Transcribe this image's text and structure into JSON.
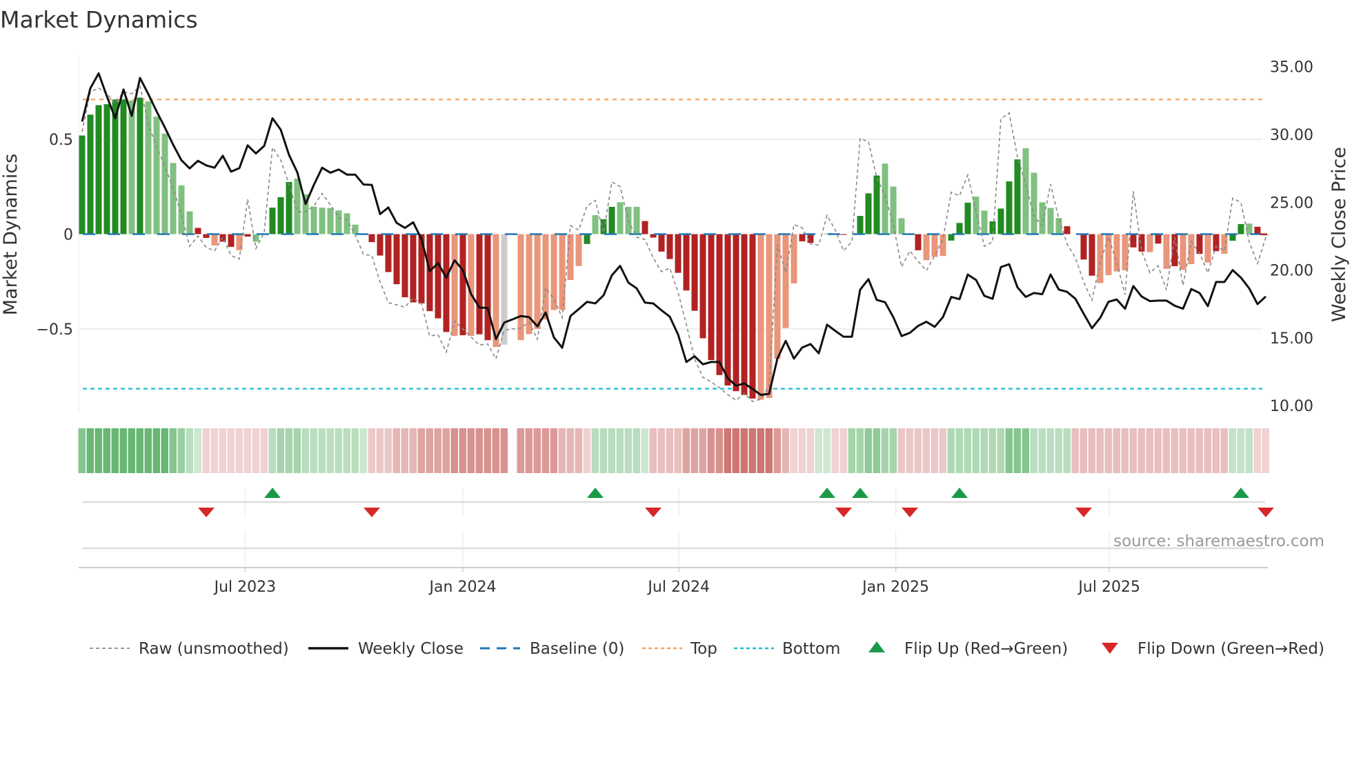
{
  "chart_data": {
    "type": "bar",
    "title": "Market Dynamics",
    "ylabel_left": "Market Dynamics",
    "ylabel_right": "Weekly Close Price",
    "source": "source: sharemaestro.com",
    "x_unit": "weeks since first bar",
    "ylim_left": [
      -0.94,
      0.94
    ],
    "ylim_right": [
      9.5,
      35.8
    ],
    "left_ticks": [
      {
        "value": 0.5,
        "label": "0.5"
      },
      {
        "value": 0,
        "label": "0"
      },
      {
        "value": -0.5,
        "label": "−0.5"
      }
    ],
    "right_ticks": [
      {
        "value": 35,
        "label": "35.00"
      },
      {
        "value": 30,
        "label": "30.00"
      },
      {
        "value": 25,
        "label": "25.00"
      },
      {
        "value": 20,
        "label": "20.00"
      },
      {
        "value": 15,
        "label": "15.00"
      },
      {
        "value": 10,
        "label": "10.00"
      }
    ],
    "x_ticks": [
      {
        "label": "Jul 2023",
        "week": 19.7
      },
      {
        "label": "Jan 2024",
        "week": 46.0
      },
      {
        "label": "Jul 2024",
        "week": 72.1
      },
      {
        "label": "Jan 2025",
        "week": 98.3
      },
      {
        "label": "Jul 2025",
        "week": 124.1
      }
    ],
    "top_level": 0.71,
    "bottom_level": -0.815,
    "baseline": 0,
    "colors": {
      "G": "#228b22",
      "g": "#80c080",
      "R": "#b22222",
      "r": "#e9967a",
      "raw": "#888888",
      "close": "#111111",
      "baseline": "#1f77b4",
      "top": "#f4a460",
      "bottom": "#17becf",
      "flip_up": "#1a9a48",
      "flip_down": "#d62728",
      "strip_pos": "#3fa34d",
      "strip_neg": "#c0504d"
    },
    "dynamics": [
      0.52,
      0.63,
      0.68,
      0.685,
      0.71,
      0.71,
      0.705,
      0.72,
      0.7,
      0.62,
      0.53,
      0.375,
      0.257,
      0.12,
      0.033,
      -0.02,
      -0.06,
      -0.04,
      -0.067,
      -0.085,
      -0.013,
      -0.04,
      0,
      0.14,
      0.195,
      0.275,
      0.293,
      0.21,
      0.145,
      0.14,
      0.138,
      0.125,
      0.11,
      0.05,
      0,
      -0.042,
      -0.113,
      -0.2,
      -0.264,
      -0.333,
      -0.36,
      -0.365,
      -0.406,
      -0.444,
      -0.516,
      -0.537,
      -0.533,
      -0.537,
      -0.528,
      -0.559,
      -0.595,
      -0.583,
      null,
      -0.559,
      -0.527,
      -0.5,
      -0.45,
      -0.4,
      -0.4,
      -0.242,
      -0.168,
      -0.052,
      0.1,
      0.079,
      0.144,
      0.168,
      0.144,
      0.144,
      0.069,
      -0.018,
      -0.092,
      -0.131,
      -0.204,
      -0.297,
      -0.404,
      -0.549,
      -0.664,
      -0.743,
      -0.798,
      -0.828,
      -0.848,
      -0.867,
      -0.873,
      -0.864,
      -0.658,
      -0.495,
      -0.26,
      -0.038,
      -0.046,
      0,
      0.004,
      0,
      -0.004,
      0,
      0.096,
      0.215,
      0.309,
      0.372,
      0.251,
      0.084,
      0,
      -0.085,
      -0.137,
      -0.12,
      -0.115,
      -0.034,
      0.059,
      0.166,
      0.198,
      0.124,
      0.067,
      0.135,
      0.278,
      0.394,
      0.453,
      0.324,
      0.168,
      0.138,
      0.085,
      0.042,
      0,
      -0.134,
      -0.219,
      -0.258,
      -0.216,
      -0.197,
      -0.191,
      -0.07,
      -0.092,
      -0.095,
      -0.05,
      -0.183,
      -0.169,
      -0.188,
      -0.158,
      -0.104,
      -0.15,
      -0.09,
      -0.104,
      -0.035,
      0.053,
      0.056,
      0.039,
      -0.008
    ],
    "shades": "GGGGGGgGggggggRRrRRrRgGGGGggggggggRRRRRRRRRRRrRrRRr-rrrrrrrrrGgGGgggRRRRRRRRRRRRRRrrrrrRRggRRGGGGgggRRrrrGGGggGGGGgggggRRRRrrrrRRrRrRrrRrRrGGgR",
    "raw": [
      0.54,
      0.75,
      0.77,
      0.74,
      0.69,
      0.75,
      0.74,
      0.78,
      0.58,
      0.46,
      0.36,
      0.24,
      0.105,
      -0.064,
      -0.01,
      -0.07,
      -0.088,
      -0.016,
      -0.113,
      -0.131,
      0.184,
      -0.076,
      0.008,
      0.457,
      0.39,
      0.263,
      0.118,
      0.118,
      0.148,
      0.215,
      0.154,
      0.087,
      0.075,
      -0.004,
      -0.107,
      -0.113,
      -0.252,
      -0.361,
      -0.373,
      -0.385,
      -0.337,
      -0.367,
      -0.537,
      -0.531,
      -0.622,
      -0.458,
      -0.5,
      -0.543,
      -0.585,
      -0.579,
      -0.658,
      -0.507,
      -0.5,
      -0.495,
      -0.464,
      -0.555,
      -0.282,
      -0.343,
      -0.44,
      0.045,
      0.021,
      0.148,
      0.178,
      0.008,
      0.275,
      0.251,
      0.069,
      -0.016,
      -0.028,
      -0.125,
      -0.198,
      -0.179,
      -0.307,
      -0.476,
      -0.658,
      -0.755,
      -0.779,
      -0.81,
      -0.846,
      -0.876,
      -0.84,
      -0.882,
      -0.87,
      -0.804,
      -0.052,
      -0.204,
      0.051,
      0.033,
      -0.052,
      -0.058,
      0.099,
      0.021,
      -0.088,
      -0.04,
      0.505,
      0.487,
      0.3,
      0.202,
      0.051,
      -0.173,
      -0.088,
      -0.143,
      -0.192,
      -0.113,
      -0.028,
      0.221,
      0.202,
      0.312,
      0.118,
      -0.064,
      -0.04,
      0.608,
      0.639,
      0.408,
      0.263,
      0.093,
      0.045,
      0.263,
      0.081,
      -0.052,
      -0.125,
      -0.252,
      -0.349,
      -0.149,
      -0.016,
      -0.149,
      -0.319,
      0.227,
      -0.088,
      -0.204,
      -0.167,
      -0.295,
      -0.016,
      -0.27,
      -0.04,
      -0.1,
      -0.204,
      -0.064,
      -0.088,
      0.19,
      0.166,
      -0.04,
      -0.155,
      -0.016
    ],
    "weekly_close": [
      30.95,
      33.41,
      34.51,
      32.81,
      31.2,
      33.32,
      31.37,
      34.17,
      32.98,
      31.71,
      30.52,
      29.25,
      28.1,
      27.5,
      28.06,
      27.72,
      27.55,
      28.43,
      27.26,
      27.52,
      29.2,
      28.6,
      29.16,
      31.2,
      30.35,
      28.49,
      27.21,
      24.87,
      26.28,
      27.55,
      27.18,
      27.42,
      27.04,
      27.04,
      26.31,
      26.28,
      24.13,
      24.62,
      23.48,
      23.11,
      23.52,
      22.29,
      19.92,
      20.51,
      19.44,
      20.72,
      20.0,
      18.22,
      17.24,
      17.2,
      14.91,
      16.13,
      16.36,
      16.61,
      16.53,
      15.85,
      16.87,
      15.03,
      14.27,
      16.61,
      17.12,
      17.66,
      17.54,
      18.14,
      19.61,
      20.31,
      19.07,
      18.65,
      17.6,
      17.54,
      17.03,
      16.56,
      15.25,
      13.22,
      13.64,
      13.05,
      13.22,
      13.22,
      12.03,
      11.47,
      11.64,
      11.23,
      10.79,
      10.88,
      13.47,
      14.78,
      13.47,
      14.29,
      14.54,
      13.86,
      15.97,
      15.51,
      15.08,
      15.08,
      18.56,
      19.33,
      17.8,
      17.63,
      16.53,
      15.13,
      15.37,
      15.88,
      16.19,
      15.81,
      16.53,
      18.02,
      17.85,
      19.67,
      19.27,
      18.1,
      17.88,
      20.22,
      20.43,
      18.73,
      18.02,
      18.31,
      18.22,
      19.67,
      18.56,
      18.39,
      17.88,
      16.78,
      15.71,
      16.48,
      17.66,
      17.83,
      17.15,
      18.82,
      18.05,
      17.71,
      17.75,
      17.75,
      17.37,
      17.15,
      18.6,
      18.31,
      17.34,
      19.12,
      19.12,
      20.0,
      19.44,
      18.65,
      17.49,
      18.05
    ],
    "regime_strip_runs": [
      [
        0.55,
        1
      ],
      [
        0.7,
        10
      ],
      [
        0.55,
        1
      ],
      [
        0.45,
        1
      ],
      [
        0.3,
        1
      ],
      [
        0.2,
        1
      ],
      [
        -0.2,
        8
      ],
      [
        0.3,
        1
      ],
      [
        0.4,
        3
      ],
      [
        0.3,
        7
      ],
      [
        0.2,
        1
      ],
      [
        -0.25,
        3
      ],
      [
        -0.35,
        3
      ],
      [
        -0.45,
        4
      ],
      [
        -0.55,
        7
      ],
      [
        null,
        1
      ],
      [
        -0.5,
        5
      ],
      [
        -0.35,
        3
      ],
      [
        -0.2,
        1
      ],
      [
        0.3,
        6
      ],
      [
        0.2,
        1
      ],
      [
        -0.3,
        4
      ],
      [
        -0.45,
        3
      ],
      [
        -0.55,
        2
      ],
      [
        -0.7,
        6
      ],
      [
        -0.5,
        1
      ],
      [
        -0.35,
        1
      ],
      [
        -0.2,
        3
      ],
      [
        0.2,
        2
      ],
      [
        -0.2,
        2
      ],
      [
        0.4,
        2
      ],
      [
        0.5,
        2
      ],
      [
        0.4,
        2
      ],
      [
        -0.25,
        6
      ],
      [
        0.35,
        7
      ],
      [
        0.55,
        3
      ],
      [
        0.3,
        5
      ],
      [
        -0.3,
        19
      ],
      [
        0.25,
        3
      ],
      [
        -0.2,
        2
      ]
    ],
    "flip_up_weeks": [
      23,
      62,
      90,
      94,
      106,
      140
    ],
    "flip_down_weeks": [
      15,
      35,
      69,
      92,
      100,
      121,
      143
    ],
    "legend": [
      {
        "key": "raw",
        "label": "Raw (unsmoothed)"
      },
      {
        "key": "close",
        "label": "Weekly Close"
      },
      {
        "key": "baseline",
        "label": "Baseline (0)"
      },
      {
        "key": "top",
        "label": "Top"
      },
      {
        "key": "bottom",
        "label": "Bottom"
      },
      {
        "key": "flip_up",
        "label": "Flip Up (Red→Green)"
      },
      {
        "key": "flip_down",
        "label": "Flip Down (Green→Red)"
      }
    ],
    "legend_position": "bottom"
  }
}
